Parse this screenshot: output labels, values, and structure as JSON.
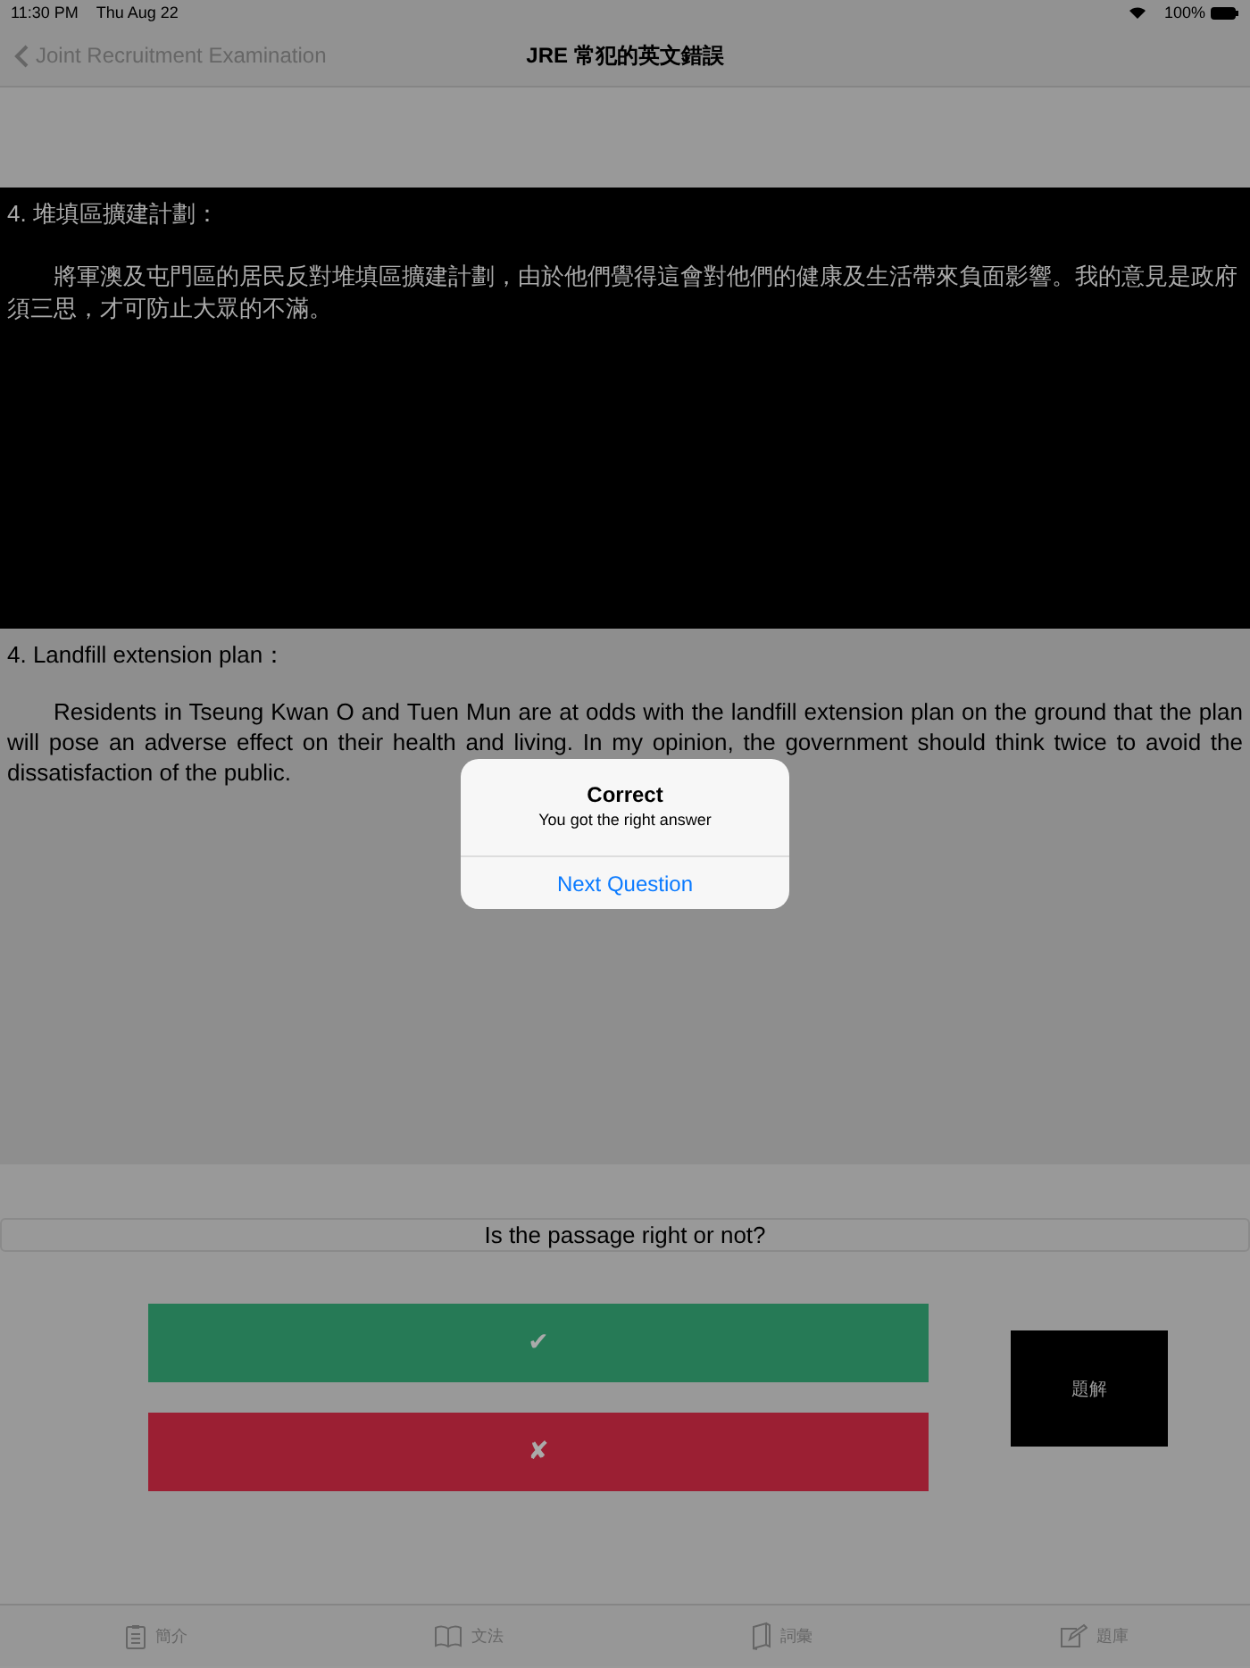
{
  "status_bar": {
    "time": "11:30 PM",
    "date": "Thu Aug 22",
    "battery_text": "100%"
  },
  "nav": {
    "back_label": "Joint Recruitment Examination",
    "title": "JRE 常犯的英文錯誤"
  },
  "chinese_passage": {
    "heading": "4. 堆填區擴建計劃：",
    "body": "將軍澳及屯門區的居民反對堆填區擴建計劃，由於他們覺得這會對他們的健康及生活帶來負面影響。我的意見是政府須三思，才可防止大眾的不滿。"
  },
  "english_passage": {
    "heading": "4. Landfill extension plan：",
    "body": "Residents in Tseung Kwan O and Tuen Mun are at odds with the landfill extension plan on the ground that the plan will pose an adverse effect on their health and living. In my opinion, the government should think twice to avoid the dissatisfaction of the public."
  },
  "question": "Is the passage right or not?",
  "answers": [
    {
      "kind": "right",
      "symbol": "✔"
    },
    {
      "kind": "wrong",
      "symbol": "✘"
    }
  ],
  "explanation_button": "題解",
  "tabs": [
    {
      "kind": "clipboard",
      "label": "簡介"
    },
    {
      "kind": "book-open",
      "label": "文法"
    },
    {
      "kind": "book",
      "label": "詞彙"
    },
    {
      "kind": "edit",
      "label": "題庫"
    }
  ],
  "alert": {
    "title": "Correct",
    "message": "You got the right answer",
    "action": "Next Question"
  }
}
